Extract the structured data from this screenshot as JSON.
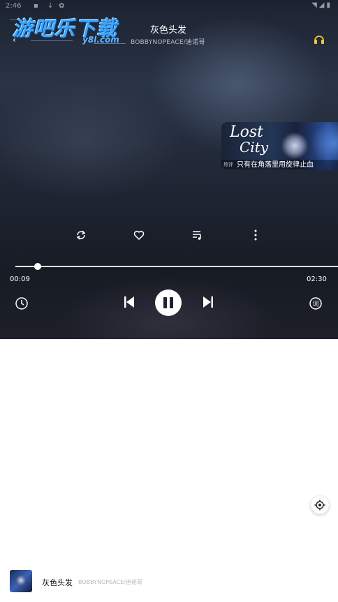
{
  "status_bar": {
    "time": "2:46"
  },
  "logo": {
    "main_text": "游吧乐下载",
    "sub_text": "y8l.com"
  },
  "song": {
    "title": "灰色头发",
    "artist": "BOBBYNOPEACE/迪诺哥"
  },
  "banner": {
    "artwork_line1": "Lost",
    "artwork_line2": "City",
    "tag": "热评",
    "caption": "只有在角落里用旋律止血"
  },
  "playback": {
    "current_time": "00:09",
    "total_time": "02:30",
    "progress_percent": 6.9,
    "state": "playing"
  },
  "icons": {
    "back": "back-arrow-icon",
    "headphone": "headphone-icon",
    "repeat": "repeat-icon",
    "like": "heart-icon",
    "playlist": "playlist-icon",
    "more": "more-vertical-icon",
    "timer": "clock-icon",
    "previous": "skip-previous-icon",
    "pause": "pause-icon",
    "next": "skip-next-icon",
    "lyrics": "lyrics-icon",
    "locate": "locate-icon"
  },
  "lyrics_toggle_label": "词",
  "mini_player": {
    "title": "灰色头发",
    "artist": "BOBBYNOPEACE/迪诺哥"
  },
  "colors": {
    "accent_logo": "#3aa6ff",
    "headphone": "#f5c43a",
    "background_page": "#ffffff"
  }
}
